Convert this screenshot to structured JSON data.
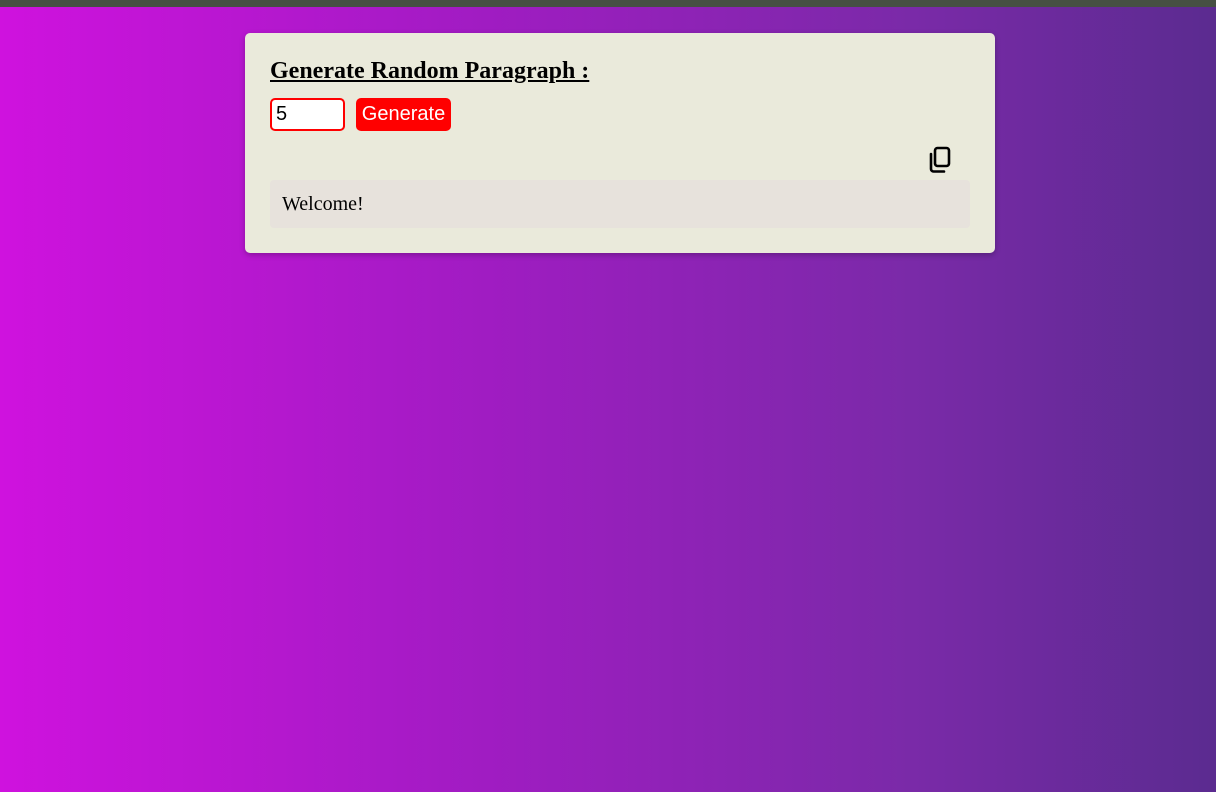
{
  "card": {
    "title": "Generate Random Paragraph :",
    "paragraph_count": "5",
    "generate_label": "Generate",
    "copy_icon": "copy-icon",
    "output_text": "Welcome!"
  },
  "colors": {
    "background_start": "#cf12de",
    "background_end": "#5b2b90",
    "top_strip": "#465043",
    "card_background": "#eaeadb",
    "accent": "#ff0000",
    "output_background": "#e7e2dc"
  }
}
